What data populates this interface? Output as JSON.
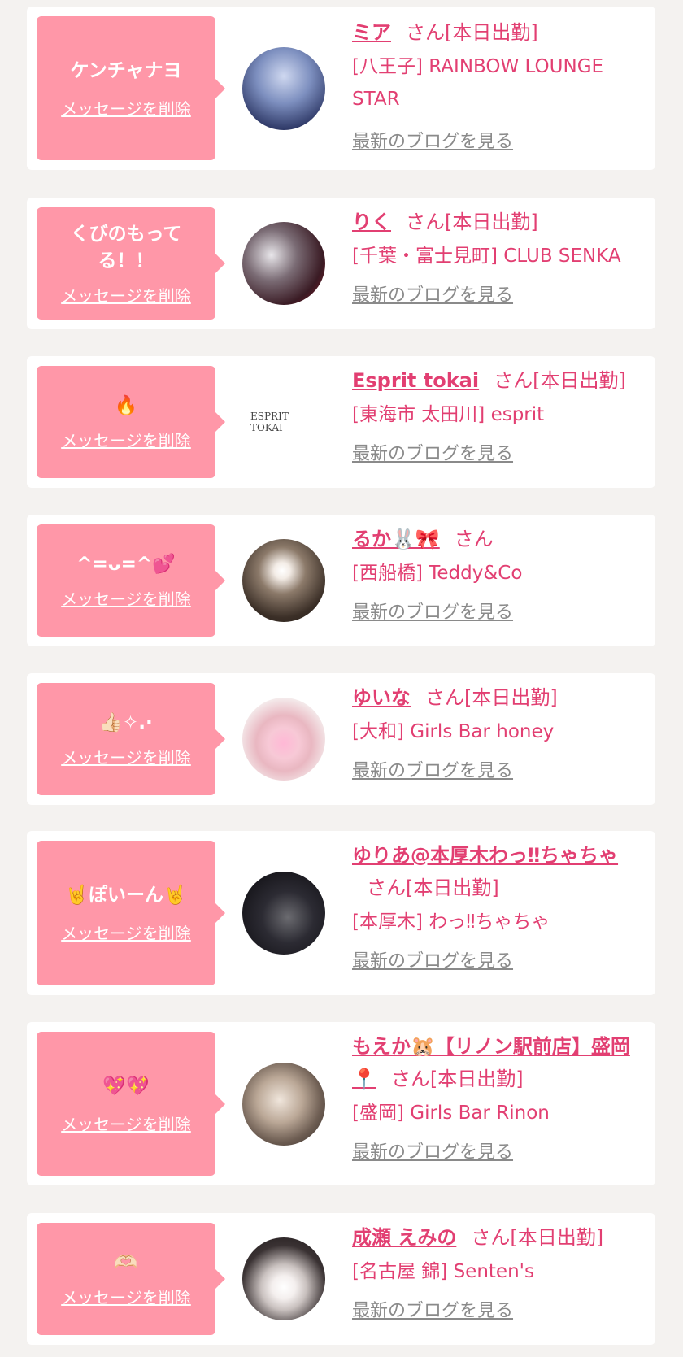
{
  "cards": [
    {
      "message": "ケンチャナヨ",
      "delete_label": "メッセージを削除",
      "name": "ミア",
      "suffix": "さん[本日出勤]",
      "shop": "[八王子] RAINBOW LOUNGE STAR",
      "blog_label": "最新のブログを見る",
      "avatar": "photo"
    },
    {
      "message": "くびのもってる！！",
      "delete_label": "メッセージを削除",
      "name": "りく",
      "suffix": "さん[本日出勤]",
      "shop": "[千葉・富士見町] CLUB SENKA",
      "blog_label": "最新のブログを見る",
      "avatar": "photo"
    },
    {
      "message": "🔥",
      "delete_label": "メッセージを削除",
      "name": "Esprit tokai",
      "suffix": "さん[本日出勤]",
      "shop": "[東海市 太田川] esprit",
      "blog_label": "最新のブログを見る",
      "avatar": "logo",
      "logo_text": "ESPRIT TOKAI"
    },
    {
      "message": "^=ᴗ=^💕",
      "delete_label": "メッセージを削除",
      "name": "るか🐰🎀",
      "suffix": "さん",
      "shop": "[西船橋] Teddy&Co",
      "blog_label": "最新のブログを見る",
      "avatar": "photo"
    },
    {
      "message": "👍🏻✧.·",
      "delete_label": "メッセージを削除",
      "name": "ゆいな",
      "suffix": "さん[本日出勤]",
      "shop": "[大和] Girls Bar honey",
      "blog_label": "最新のブログを見る",
      "avatar": "photo"
    },
    {
      "message": "🤘ぽいーん🤘",
      "delete_label": "メッセージを削除",
      "name": "ゆりあ@本厚木わっ‼ちゃちゃ",
      "suffix": "さん[本日出勤]",
      "shop": "[本厚木] わっ‼ちゃちゃ",
      "blog_label": "最新のブログを見る",
      "avatar": "photo"
    },
    {
      "message": "💖💖",
      "delete_label": "メッセージを削除",
      "name": "もえか🐹【リノン駅前店】盛岡📍",
      "suffix": "さん[本日出勤]",
      "shop": "[盛岡] Girls Bar Rinon",
      "blog_label": "最新のブログを見る",
      "avatar": "photo"
    },
    {
      "message": "🫶🏻",
      "delete_label": "メッセージを削除",
      "name": "成瀬 えみの",
      "suffix": "さん[本日出勤]",
      "shop": "[名古屋 錦] Senten's",
      "blog_label": "最新のブログを見る",
      "avatar": "photo"
    }
  ],
  "colors": {
    "accent": "#e23f72",
    "bubble": "#ff97a8",
    "page_bg": "#f4f2f0",
    "link_gray": "#8a8a8a"
  }
}
